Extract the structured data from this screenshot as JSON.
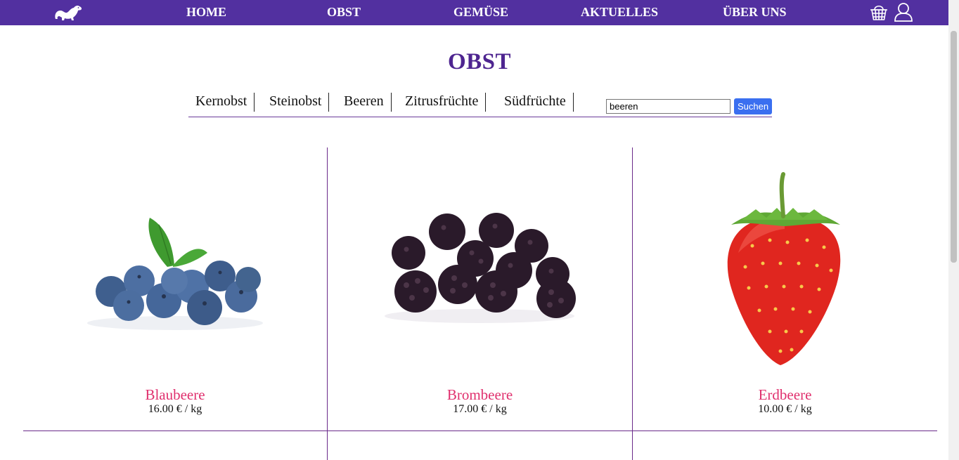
{
  "nav": {
    "logo_icon": "ferret-logo-icon",
    "items": [
      {
        "label": "HOME"
      },
      {
        "label": "OBST"
      },
      {
        "label": "GEMÜSE"
      },
      {
        "label": "AKTUELLES"
      },
      {
        "label": "ÜBER UNS"
      }
    ],
    "cart_icon": "basket-icon",
    "user_icon": "user-icon"
  },
  "page": {
    "title": "OBST"
  },
  "categories": [
    {
      "label": "Kernobst"
    },
    {
      "label": "Steinobst"
    },
    {
      "label": "Beeren"
    },
    {
      "label": "Zitrusfrüchte"
    },
    {
      "label": "Südfrüchte"
    }
  ],
  "search": {
    "value": "beeren",
    "button_label": "Suchen"
  },
  "products": [
    {
      "name": "Blaubeere",
      "price": "16.00",
      "currency": "€",
      "unit": "/ kg",
      "image_icon": "blueberries-image"
    },
    {
      "name": "Brombeere",
      "price": "17.00",
      "currency": "€",
      "unit": "/ kg",
      "image_icon": "blackberries-image"
    },
    {
      "name": "Erdbeere",
      "price": "10.00",
      "currency": "€",
      "unit": "/ kg",
      "image_icon": "strawberry-image"
    }
  ],
  "colors": {
    "nav_bg": "#5230a0",
    "title": "#4e2590",
    "product_name": "#e0306e",
    "divider": "#6a2a8a",
    "search_button": "#3a6ff0"
  }
}
